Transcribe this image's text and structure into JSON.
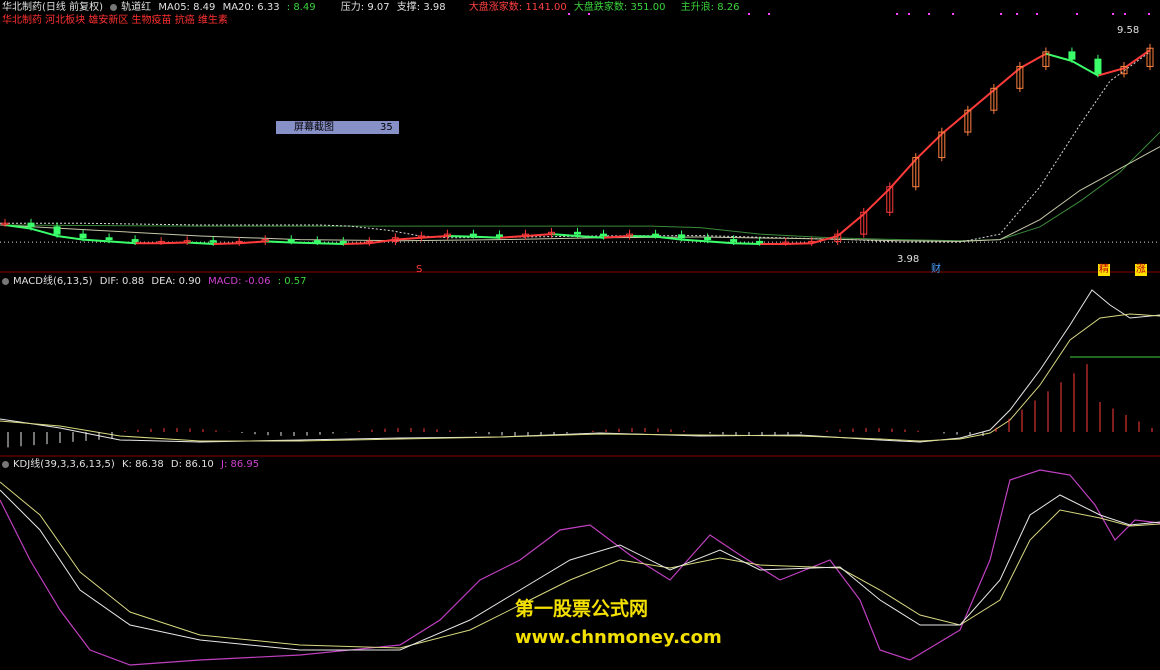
{
  "header": {
    "stock_name": "华北制药(日线 前复权)",
    "indicator": "轨道红",
    "ma05_label": "MA05: 8.49",
    "ma20_label": "MA20: 6.33",
    "ma_extra": ": 8.49",
    "pressure": "压力: 9.07",
    "support": "支撑: 3.98",
    "up_count": "大盘涨家数: 1141.00",
    "down_count": "大盘跌家数: 351.00",
    "main_wave": "主升浪: 8.26",
    "concepts": "华北制药 河北板块 雄安新区 生物疫苗 抗癌 维生素"
  },
  "tooltip": {
    "label": "屏幕截图",
    "value": "35"
  },
  "price_panel": {
    "high_label": "9.58",
    "low_label": "3.98",
    "markers": [
      "S",
      "财",
      "精",
      "涨"
    ]
  },
  "macd_panel": {
    "title": "MACD线(6,13,5)",
    "dif": "DIF: 0.88",
    "dea": "DEA: 0.90",
    "macd": "MACD: -0.06",
    "extra": ": 0.57"
  },
  "kdj_panel": {
    "title": "KDJ线(39,3,3,6,13,5)",
    "k": "K: 86.38",
    "d": "D: 86.10",
    "j": "J: 86.95"
  },
  "watermark": {
    "line1": "第一股票公式网",
    "line2": "www.chnmoney.com"
  },
  "colors": {
    "up": "#ff3b3b",
    "down": "#3bff6a",
    "yellow": "#ffe000",
    "white": "#e8e8e8",
    "magenta": "#c040c0",
    "green_line": "#3a9a3a",
    "dotted": "#d8d8d8"
  },
  "chart_data": [
    {
      "type": "candlestick",
      "title": "华北制药(日线 前复权)",
      "series": [
        {
          "name": "MA05",
          "last": 8.49
        },
        {
          "name": "MA20",
          "last": 6.33
        }
      ],
      "annotations": {
        "high": 9.58,
        "low": 3.98,
        "pressure": 9.07,
        "support": 3.98
      },
      "close_approx": [
        4.5,
        4.4,
        4.2,
        4.1,
        4.05,
        4.0,
        4.0,
        4.02,
        3.98,
        4.0,
        4.05,
        4.02,
        4.0,
        3.98,
        4.0,
        4.1,
        4.15,
        4.2,
        4.18,
        4.15,
        4.2,
        4.25,
        4.2,
        4.15,
        4.2,
        4.18,
        4.1,
        4.05,
        4.0,
        3.98,
        3.98,
        4.0,
        4.2,
        4.8,
        5.5,
        6.3,
        7.0,
        7.6,
        8.2,
        8.8,
        9.2,
        9.0,
        8.6,
        8.8,
        9.3
      ]
    },
    {
      "type": "line",
      "title": "MACD线(6,13,5)",
      "series": [
        {
          "name": "DIF",
          "last": 0.88
        },
        {
          "name": "DEA",
          "last": 0.9
        },
        {
          "name": "MACD",
          "last": -0.06
        }
      ]
    },
    {
      "type": "line",
      "title": "KDJ线(39,3,3,6,13,5)",
      "series": [
        {
          "name": "K",
          "last": 86.38
        },
        {
          "name": "D",
          "last": 86.1
        },
        {
          "name": "J",
          "last": 86.95
        }
      ]
    }
  ]
}
